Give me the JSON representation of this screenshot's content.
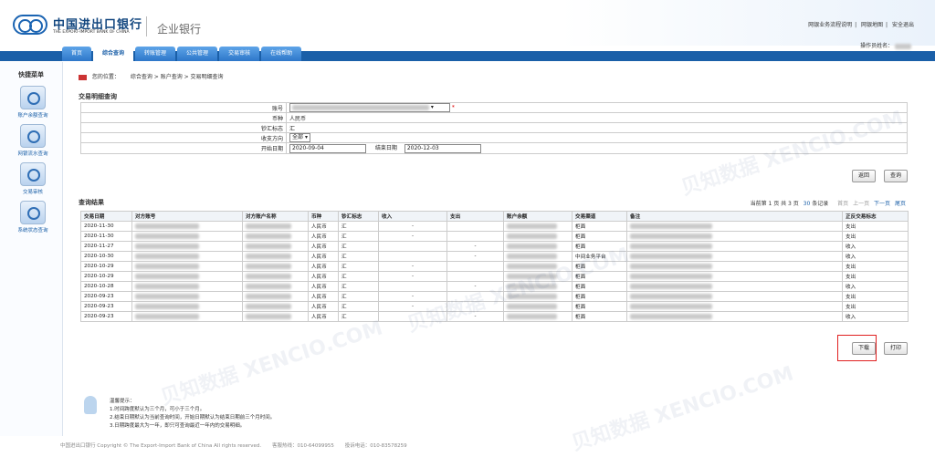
{
  "header": {
    "bank_name_cn": "中国进出口银行",
    "bank_name_en": "THE EXPORT-IMPORT BANK OF CHINA",
    "system_name": "企业银行",
    "links": [
      "网银业务流程说明",
      "网银地图",
      "安全退出"
    ],
    "operator_label": "操作员姓名："
  },
  "tabs": [
    "首页",
    "综合查询",
    "转账管理",
    "公共管理",
    "交易审核",
    "在线帮助"
  ],
  "sidebar": {
    "title": "快捷菜单",
    "items": [
      "账户余额查询",
      "网银流水查询",
      "交易审核",
      "系统状态查询"
    ]
  },
  "breadcrumb": {
    "label": "您的位置：",
    "path": "综合查询 > 账户查询 > 交易明细查询"
  },
  "query_form": {
    "title": "交易明细查询",
    "account_label": "账号",
    "currency_label": "币种",
    "currency_value": "人民币",
    "cash_label": "钞汇标志",
    "cash_value": "汇",
    "direction_label": "收支方向",
    "direction_value": "全部",
    "start_label": "开始日期",
    "start_value": "2020-09-04",
    "end_label": "结束日期",
    "end_value": "2020-12-03",
    "return_button": "返回",
    "query_button": "查询"
  },
  "results": {
    "title": "查询结果",
    "page_info": "当前第 1 页 共 3 页",
    "record_count": "30",
    "record_suffix": "条记录",
    "pager": [
      "首页",
      "上一页",
      "下一页",
      "尾页"
    ],
    "columns": [
      "交易日期",
      "对方账号",
      "对方账户名称",
      "币种",
      "钞汇标志",
      "收入",
      "支出",
      "账户余额",
      "交易渠道",
      "备注",
      "正反交易标志"
    ],
    "rows": [
      {
        "date": "2020-11-30",
        "currency": "人民币",
        "cash": "汇",
        "income": "-",
        "expense": "",
        "channel": "柜面",
        "flag": "支出"
      },
      {
        "date": "2020-11-30",
        "currency": "人民币",
        "cash": "汇",
        "income": "-",
        "expense": "",
        "channel": "柜面",
        "flag": "支出"
      },
      {
        "date": "2020-11-27",
        "currency": "人民币",
        "cash": "汇",
        "income": "",
        "expense": "-",
        "channel": "柜面",
        "flag": "收入"
      },
      {
        "date": "2020-10-30",
        "currency": "人民币",
        "cash": "汇",
        "income": "",
        "expense": "-",
        "channel": "中间业务平台",
        "flag": "收入"
      },
      {
        "date": "2020-10-29",
        "currency": "人民币",
        "cash": "汇",
        "income": "-",
        "expense": "",
        "channel": "柜面",
        "flag": "支出"
      },
      {
        "date": "2020-10-29",
        "currency": "人民币",
        "cash": "汇",
        "income": "-",
        "expense": "",
        "channel": "柜面",
        "flag": "支出"
      },
      {
        "date": "2020-10-28",
        "currency": "人民币",
        "cash": "汇",
        "income": "",
        "expense": "-",
        "channel": "柜面",
        "flag": "收入"
      },
      {
        "date": "2020-09-23",
        "currency": "人民币",
        "cash": "汇",
        "income": "-",
        "expense": "",
        "channel": "柜面",
        "flag": "支出"
      },
      {
        "date": "2020-09-23",
        "currency": "人民币",
        "cash": "汇",
        "income": "-",
        "expense": "",
        "channel": "柜面",
        "flag": "支出"
      },
      {
        "date": "2020-09-23",
        "currency": "人民币",
        "cash": "汇",
        "income": "",
        "expense": "-",
        "channel": "柜面",
        "flag": "收入"
      }
    ],
    "download_button": "下载",
    "print_button": "打印"
  },
  "tips": {
    "title": "温馨提示：",
    "lines": [
      "1.时间跨度默认为三个月，可小于三个月。",
      "2.结束日期默认为当前查询时间，开始日期默认为结束日期前三个月时间。",
      "3.日期跨度最大为一年，即只可查询最近一年内的交易明细。"
    ]
  },
  "footer": {
    "copyright": "中国进出口银行 Copyright © The Export-Import Bank of China All rights reserved.",
    "hotline_label": "客服热线：",
    "hotline": "010-64099955",
    "fax_label": "投诉电话：",
    "fax": "010-83578259"
  },
  "watermark": "贝知数据 XENCIO.COM"
}
